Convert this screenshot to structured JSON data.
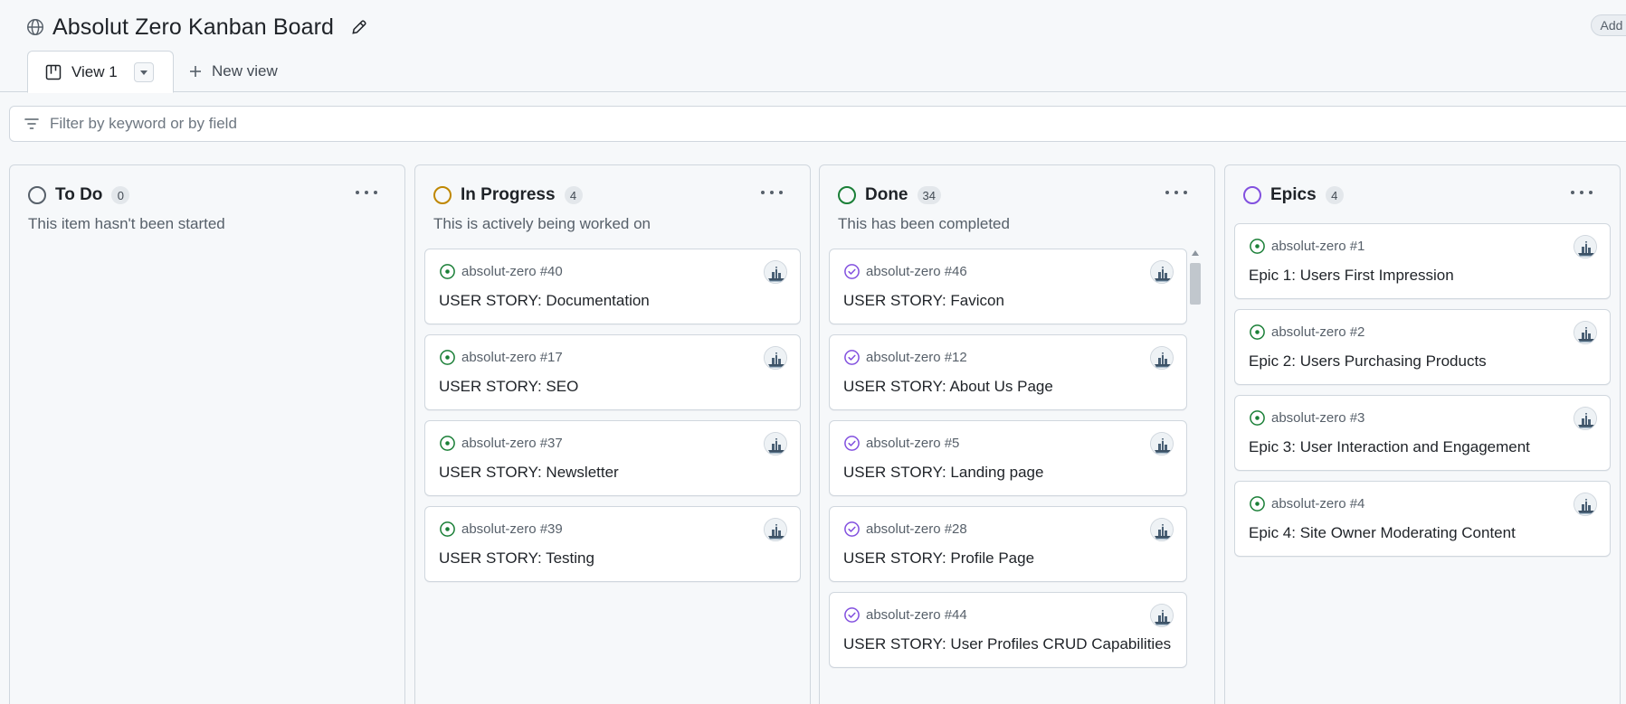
{
  "header": {
    "globe_icon": "globe-icon",
    "title": "Absolut Zero Kanban Board",
    "edit_icon": "pencil-icon",
    "add_status_label": "Add sta"
  },
  "tabs": {
    "view": {
      "label": "View 1",
      "icon": "board-icon",
      "dropdown_icon": "caret-down-icon"
    },
    "new_view": {
      "label": "New view",
      "icon": "plus-icon"
    }
  },
  "filter": {
    "placeholder": "Filter by keyword or by field",
    "icon": "filter-icon"
  },
  "colors": {
    "todo": "#57606a",
    "in_progress": "#bf8700",
    "done": "#1a7f37",
    "epics": "#8250df",
    "open_issue": "#1a7f37",
    "closed_issue": "#8250df"
  },
  "columns": [
    {
      "name": "To Do",
      "count": "0",
      "description": "This item hasn't been started",
      "cards": []
    },
    {
      "name": "In Progress",
      "count": "4",
      "description": "This is actively being worked on",
      "cards": [
        {
          "ref": "absolut-zero #40",
          "title": "USER STORY: Documentation",
          "state": "open"
        },
        {
          "ref": "absolut-zero #17",
          "title": "USER STORY: SEO",
          "state": "open"
        },
        {
          "ref": "absolut-zero #37",
          "title": "USER STORY: Newsletter",
          "state": "open"
        },
        {
          "ref": "absolut-zero #39",
          "title": "USER STORY: Testing",
          "state": "open"
        }
      ]
    },
    {
      "name": "Done",
      "count": "34",
      "description": "This has been completed",
      "cards": [
        {
          "ref": "absolut-zero #46",
          "title": "USER STORY: Favicon",
          "state": "closed"
        },
        {
          "ref": "absolut-zero #12",
          "title": "USER STORY: About Us Page",
          "state": "closed"
        },
        {
          "ref": "absolut-zero #5",
          "title": "USER STORY: Landing page",
          "state": "closed"
        },
        {
          "ref": "absolut-zero #28",
          "title": "USER STORY: Profile Page",
          "state": "closed"
        },
        {
          "ref": "absolut-zero #44",
          "title": "USER STORY: User Profiles CRUD Capabilities",
          "state": "closed"
        }
      ]
    },
    {
      "name": "Epics",
      "count": "4",
      "description": "",
      "cards": [
        {
          "ref": "absolut-zero #1",
          "title": "Epic 1: Users First Impression",
          "state": "open"
        },
        {
          "ref": "absolut-zero #2",
          "title": "Epic 2: Users Purchasing Products",
          "state": "open"
        },
        {
          "ref": "absolut-zero #3",
          "title": "Epic 3: User Interaction and Engagement",
          "state": "open"
        },
        {
          "ref": "absolut-zero #4",
          "title": "Epic 4: Site Owner Moderating Content",
          "state": "open"
        }
      ]
    }
  ]
}
